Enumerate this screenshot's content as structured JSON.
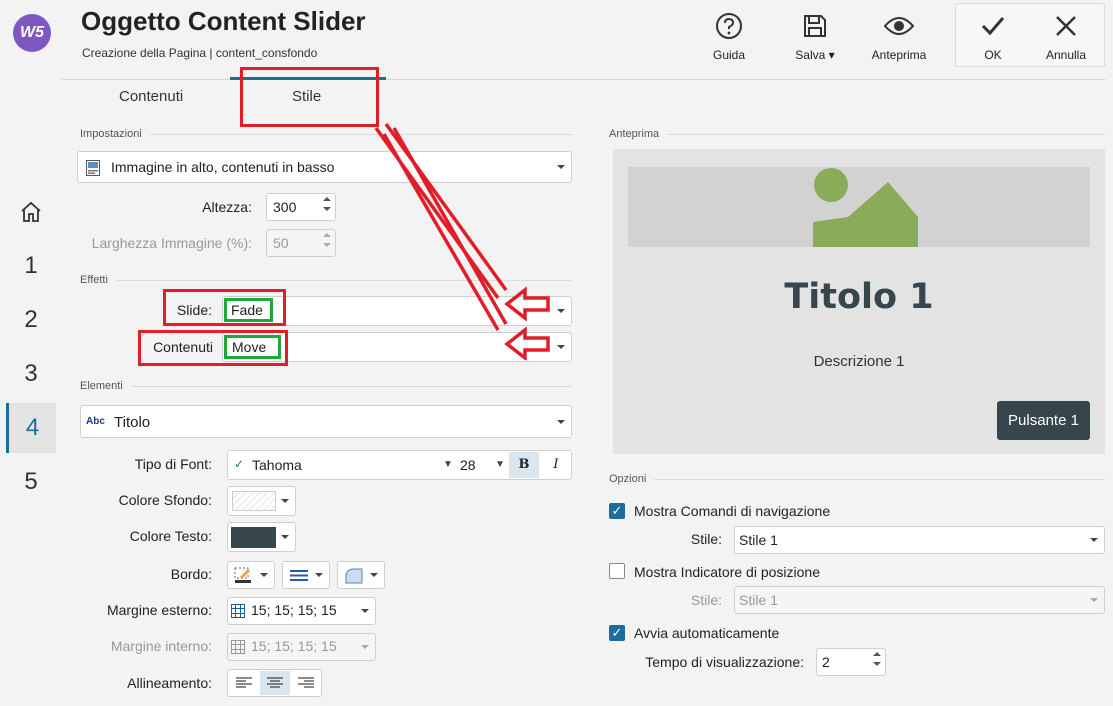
{
  "app": {
    "logo_text": "W5",
    "title": "Oggetto Content Slider",
    "subtitle": "Creazione della Pagina | content_consfondo"
  },
  "rail": {
    "steps": [
      "1",
      "2",
      "3",
      "4",
      "5"
    ],
    "active_step": "4"
  },
  "toolbar": {
    "guide_label": "Guida",
    "save_label": "Salva",
    "preview_label": "Anteprima",
    "ok_label": "OK",
    "cancel_label": "Annulla"
  },
  "tabs": [
    {
      "label": "Contenuti",
      "active": false
    },
    {
      "label": "Stile",
      "active": true
    }
  ],
  "settings": {
    "heading": "Impostazioni",
    "layout_value": "Immagine in alto, contenuti in basso",
    "height_label": "Altezza:",
    "height_value": "300",
    "img_width_label": "Larghezza Immagine (%):",
    "img_width_value": "50"
  },
  "effects": {
    "heading": "Effetti",
    "slide_label": "Slide:",
    "slide_value": "Fade",
    "content_label": "Contenuti",
    "content_value": "Move"
  },
  "elements": {
    "heading": "Elementi",
    "selected_icon": "Abc",
    "selected": "Titolo",
    "font_label": "Tipo di Font:",
    "font_value": "Tahoma",
    "font_size": "28",
    "bold_label": "B",
    "italic_label": "I",
    "bg_color_label": "Colore Sfondo:",
    "text_color_label": "Colore Testo:",
    "text_color": "#37454d",
    "border_label": "Bordo:",
    "outer_margin_label": "Margine esterno:",
    "outer_margin_value": "15; 15; 15; 15",
    "inner_margin_label": "Margine interno:",
    "inner_margin_value": "15; 15; 15; 15",
    "align_label": "Allineamento:"
  },
  "preview": {
    "heading": "Anteprima",
    "title": "Titolo 1",
    "description": "Descrizione 1",
    "button": "Pulsante 1",
    "image_color": "#8bab58"
  },
  "options": {
    "heading": "Opzioni",
    "show_nav_label": "Mostra Comandi di navigazione",
    "show_nav_checked": true,
    "nav_style_label": "Stile:",
    "nav_style_value": "Stile 1",
    "show_pos_label": "Mostra Indicatore di posizione",
    "show_pos_checked": false,
    "pos_style_label": "Stile:",
    "pos_style_value": "Stile 1",
    "autoplay_label": "Avvia automaticamente",
    "autoplay_checked": true,
    "display_time_label": "Tempo di visualizzazione:",
    "display_time_value": "2"
  },
  "colors": {
    "accent": "#1b6e9a",
    "annotation_red": "#e11d2a",
    "annotation_green": "#1fa83a",
    "preview_button": "#37454d"
  }
}
